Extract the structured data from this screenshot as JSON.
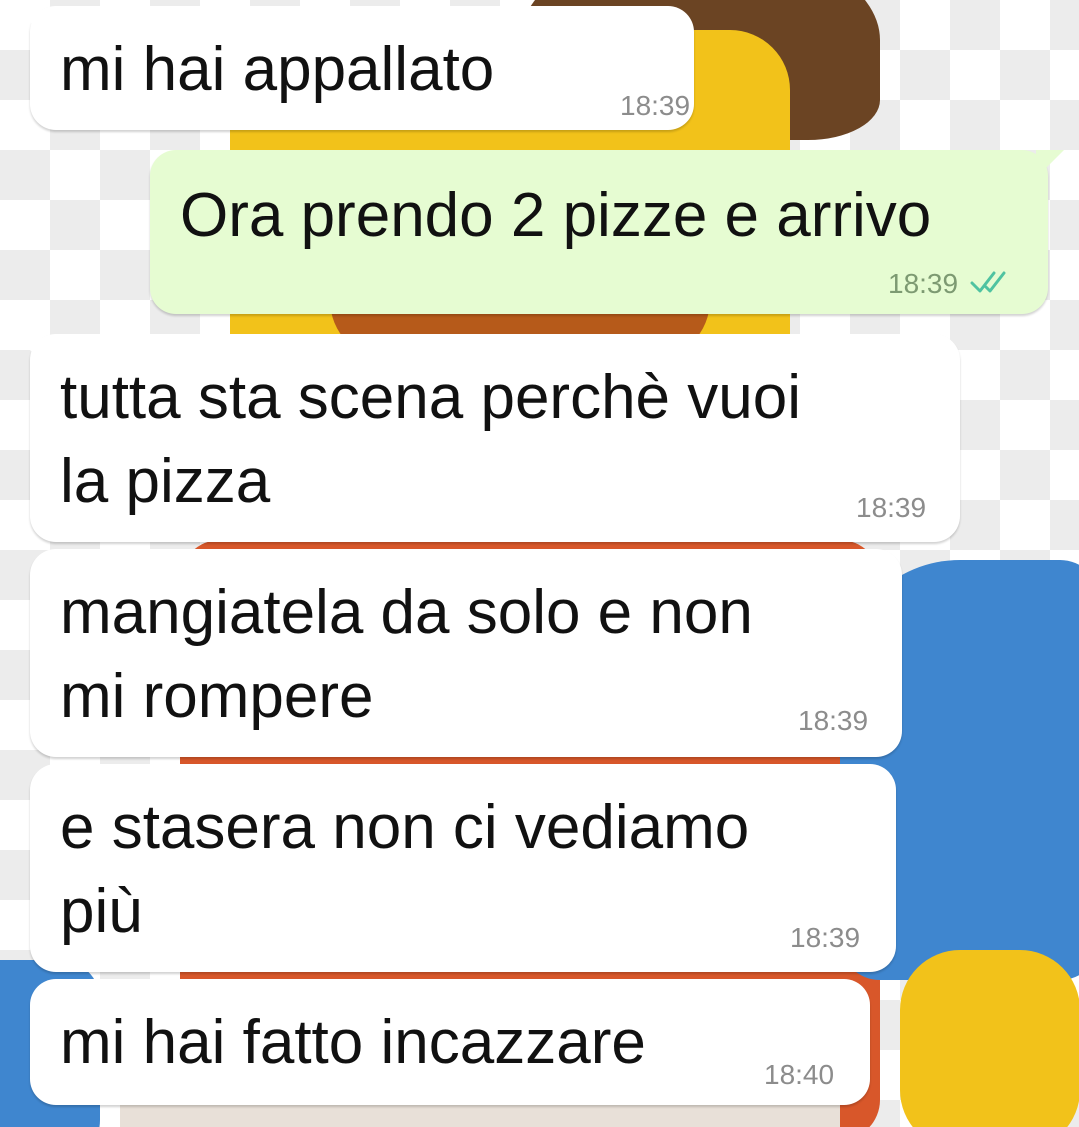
{
  "messages": [
    {
      "direction": "incoming",
      "text": "mi hai appallato",
      "time": "18:39"
    },
    {
      "direction": "outgoing",
      "text": "Ora prendo 2 pizze e arrivo",
      "time": "18:39",
      "status": "read",
      "status_icon": "double-check-icon",
      "status_color": "#4fc3a1"
    },
    {
      "direction": "incoming",
      "text": "tutta sta scena perchè vuoi\nla pizza",
      "time": "18:39"
    },
    {
      "direction": "incoming",
      "text": "mangiatela da solo e non\nmi rompere",
      "time": "18:39"
    },
    {
      "direction": "incoming",
      "text": "e stasera non ci vediamo\npiù",
      "time": "18:39"
    },
    {
      "direction": "incoming",
      "text": "mi hai fatto incazzare",
      "time": "18:40"
    }
  ],
  "colors": {
    "incoming_bubble": "#ffffff",
    "outgoing_bubble": "#e6fcd2",
    "timestamp": "#8c8c8c",
    "read_ticks": "#4fc3a1"
  },
  "wallpaper": {
    "description_icon": "lego-figure-wallpaper"
  }
}
